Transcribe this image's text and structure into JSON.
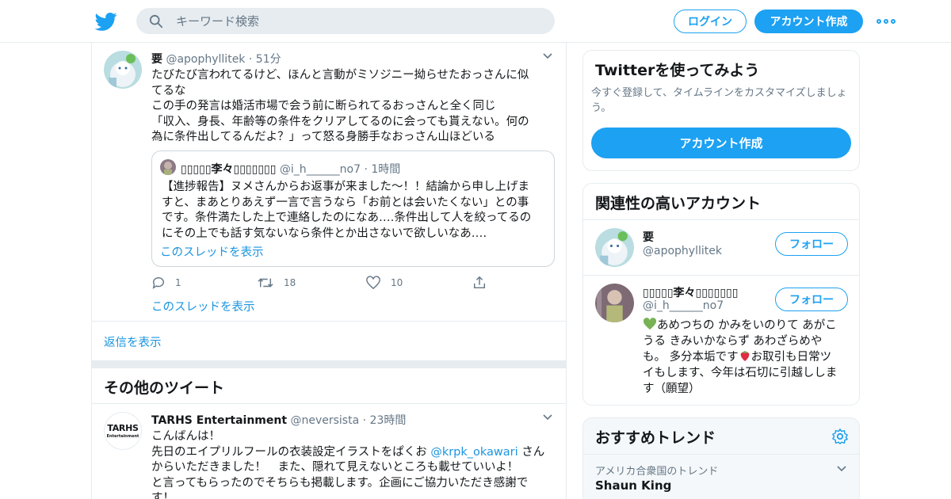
{
  "header": {
    "search_placeholder": "キーワード検索",
    "login_label": "ログイン",
    "signup_label": "アカウント作成"
  },
  "tweet": {
    "name": "要",
    "handle": "@apophyllitek",
    "dot": "·",
    "time": "51分",
    "text": "たびたび言われてるけど、ほんと言動がミソジニー拗らせたおっさんに似\nてるな\nこの手の発言は婚活市場で会う前に断られてるおっさんと全く同じ\n「収入、身長、年齢等の条件をクリアしてるのに会っても貰えない。何の\n為に条件出してるんだよ？」って怒る身勝手なおっさん山ほどいる",
    "quote": {
      "name": "▯▯▯▯▯李々▯▯▯▯▯▯▯",
      "handle": "@i_h______no7",
      "dot": "·",
      "time": "1時間",
      "text": "【進捗報告】ヌメさんからお返事が来ました〜！！結論から申し上げま\nすと、まあとりあえず一言で言うなら「お前とは会いたくない」との事\nです。条件満たした上で連絡したのになあ‥‥条件出して人を絞ってるの\nにその上でも話す気ないなら条件とか出さないで欲しいなあ‥‥",
      "thread_link": "このスレッドを表示"
    },
    "replies": "1",
    "retweets": "18",
    "likes": "10",
    "thread_link": "このスレッドを表示"
  },
  "show_replies": "返信を表示",
  "more_tweets_title": "その他のツイート",
  "tweet2": {
    "avatar_text_top": "TARHS",
    "avatar_text_bottom": "Entertainment",
    "name": "TARHS Entertainment",
    "handle": "@neversista",
    "dot": "·",
    "time": "23時間",
    "line1": "こんばんは！",
    "line2_pre": "先日のエイプリルフールの衣装設定イラストをぱくお ",
    "mention": "@krpk_okawari",
    "line2_post": " さん",
    "rest": "からいただきました！　また、隠れて見えないところも載せていいよ！\nと言ってもらったのでそちらも掲載します。企画にご協力いただき感謝で\nす！"
  },
  "signup_card": {
    "title": "Twitterを使ってみよう",
    "desc": "今すぐ登録して、タイムラインをカスタマイズしましょ\nう。",
    "button": "アカウント作成"
  },
  "related": {
    "title": "関連性の高いアカウント",
    "follow_label": "フォロー",
    "accounts": [
      {
        "name": "要",
        "handle": "@apophyllitek"
      },
      {
        "name": "▯▯▯▯▯李々▯▯▯▯▯▯▯",
        "handle": "@i_h______no7",
        "bio_pre": "あめつちの かみをいのりて あがこ\nうる きみいかならず あわざらめや\nも。 多分本垢です",
        "bio_post": "お取引も日常ツ\nイもします、今年は石切に引越ししま\nす（願望）"
      }
    ]
  },
  "trends": {
    "title": "おすすめトレンド",
    "context": "アメリカ合衆国のトレンド",
    "first": "Shaun King"
  },
  "colors": {
    "accent": "#1da1f2",
    "link": "#1b95e0",
    "muted": "#657786",
    "border": "#e6ecf0"
  }
}
